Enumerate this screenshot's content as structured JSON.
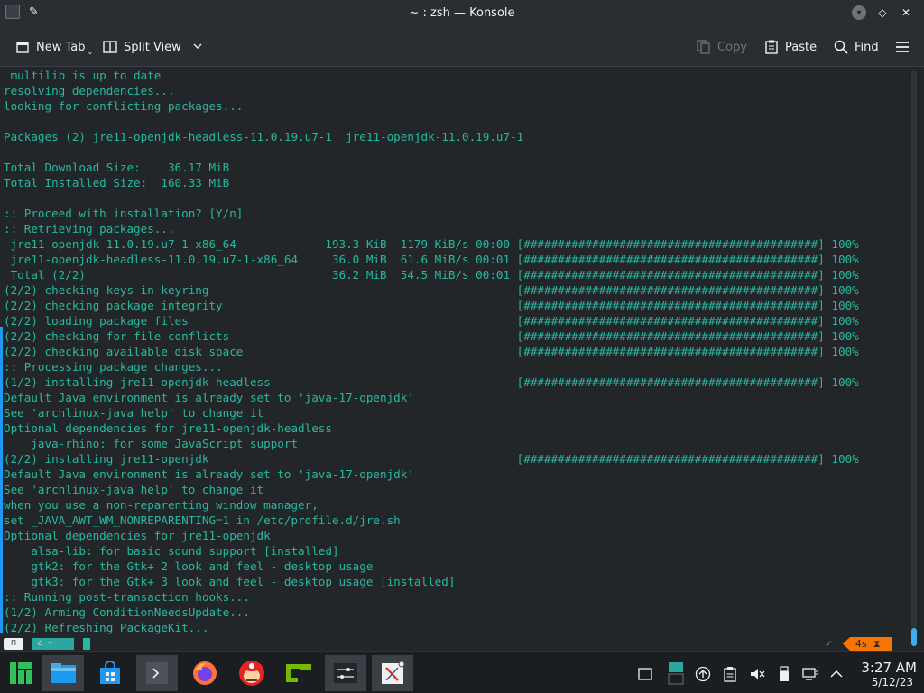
{
  "window": {
    "title": "~ : zsh — Konsole"
  },
  "toolbar": {
    "new_tab": "New Tab",
    "split_view": "Split View",
    "copy": "Copy",
    "paste": "Paste",
    "find": "Find"
  },
  "terminal": {
    "lines": [
      " multilib is up to date",
      "resolving dependencies...",
      "looking for conflicting packages...",
      "",
      "Packages (2) jre11-openjdk-headless-11.0.19.u7-1  jre11-openjdk-11.0.19.u7-1",
      "",
      "Total Download Size:    36.17 MiB",
      "Total Installed Size:  160.33 MiB",
      "",
      ":: Proceed with installation? [Y/n]",
      ":: Retrieving packages...",
      " jre11-openjdk-11.0.19.u7-1-x86_64             193.3 KiB  1179 KiB/s 00:00 [###########################################] 100%",
      " jre11-openjdk-headless-11.0.19.u7-1-x86_64     36.0 MiB  61.6 MiB/s 00:01 [###########################################] 100%",
      " Total (2/2)                                    36.2 MiB  54.5 MiB/s 00:01 [###########################################] 100%",
      "(2/2) checking keys in keyring                                             [###########################################] 100%",
      "(2/2) checking package integrity                                           [###########################################] 100%",
      "(2/2) loading package files                                                [###########################################] 100%",
      "(2/2) checking for file conflicts                                          [###########################################] 100%",
      "(2/2) checking available disk space                                        [###########################################] 100%",
      ":: Processing package changes...",
      "(1/2) installing jre11-openjdk-headless                                    [###########################################] 100%",
      "Default Java environment is already set to 'java-17-openjdk'",
      "See 'archlinux-java help' to change it",
      "Optional dependencies for jre11-openjdk-headless",
      "    java-rhino: for some JavaScript support",
      "(2/2) installing jre11-openjdk                                             [###########################################] 100%",
      "Default Java environment is already set to 'java-17-openjdk'",
      "See 'archlinux-java help' to change it",
      "when you use a non-reparenting window manager,",
      "set _JAVA_AWT_WM_NONREPARENTING=1 in /etc/profile.d/jre.sh",
      "Optional dependencies for jre11-openjdk",
      "    alsa-lib: for basic sound support [installed]",
      "    gtk2: for the Gtk+ 2 look and feel - desktop usage",
      "    gtk3: for the Gtk+ 3 look and feel - desktop usage [installed]",
      ":: Running post-transaction hooks...",
      "(1/2) Arming ConditionNeedsUpdate...",
      "(2/2) Refreshing PackageKit..."
    ]
  },
  "prompt": {
    "segment_os": "⊓",
    "segment_dir": "⌂ ~",
    "check": "✓",
    "elapsed": "4s ⧗"
  },
  "clock": {
    "time": "3:27 AM",
    "date": "5/12/23"
  },
  "colors": {
    "terminal_text": "#25b9a0",
    "accent": "#1d99f3",
    "elapsed_badge": "#f67400"
  }
}
